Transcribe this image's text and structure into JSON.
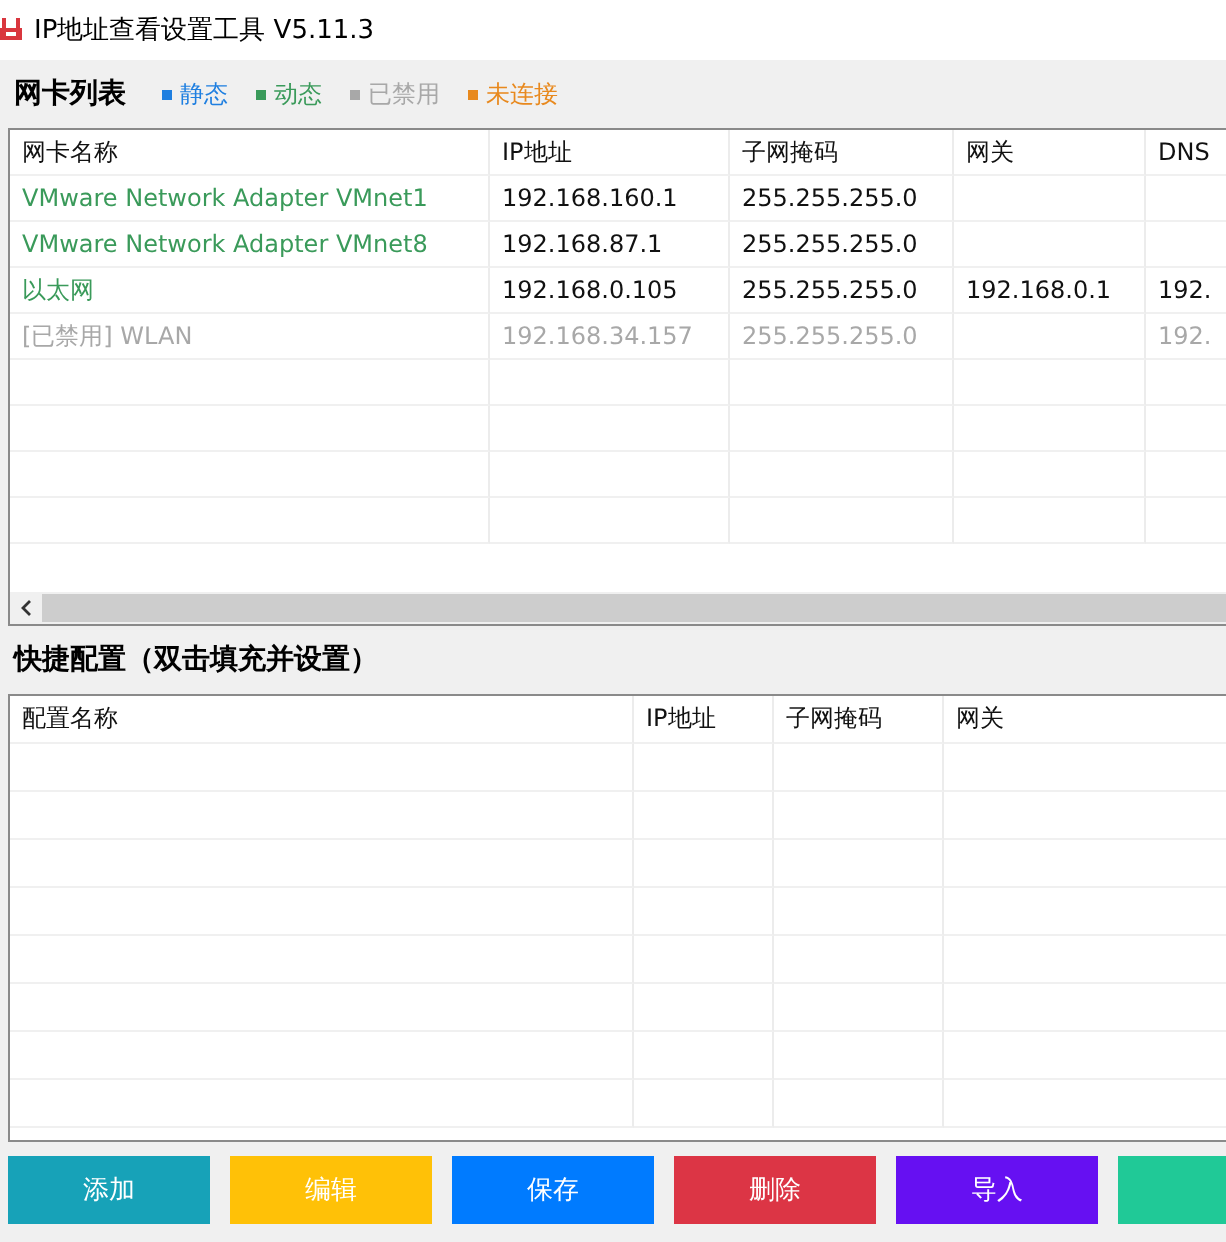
{
  "window": {
    "title": "IP地址查看设置工具 V5.11.3"
  },
  "adapters": {
    "title": "网卡列表",
    "legend": [
      {
        "label": "静态",
        "color": "#1f7fe0"
      },
      {
        "label": "动态",
        "color": "#3a9a5a"
      },
      {
        "label": "已禁用",
        "color": "#a8a8a8"
      },
      {
        "label": "未连接",
        "color": "#e8891e"
      }
    ],
    "columns": [
      "网卡名称",
      "IP地址",
      "子网掩码",
      "网关",
      "DNS"
    ],
    "rows": [
      {
        "color": "#3a9a5a",
        "disabled": false,
        "cells": [
          "VMware Network Adapter VMnet1",
          "192.168.160.1",
          "255.255.255.0",
          "",
          ""
        ]
      },
      {
        "color": "#3a9a5a",
        "disabled": false,
        "cells": [
          "VMware Network Adapter VMnet8",
          "192.168.87.1",
          "255.255.255.0",
          "",
          ""
        ]
      },
      {
        "color": "#3a9a5a",
        "disabled": false,
        "cells": [
          "以太网",
          "192.168.0.105",
          "255.255.255.0",
          "192.168.0.1",
          "192."
        ]
      },
      {
        "color": "#a8a8a8",
        "disabled": true,
        "cells": [
          "[已禁用] WLAN",
          "192.168.34.157",
          "255.255.255.0",
          "",
          "192."
        ]
      }
    ]
  },
  "quick_config": {
    "title": "快捷配置（双击填充并设置）",
    "columns": [
      "配置名称",
      "IP地址",
      "子网掩码",
      "网关"
    ]
  },
  "buttons": [
    {
      "label": "添加",
      "color": "#17a2b8"
    },
    {
      "label": "编辑",
      "color": "#ffc107"
    },
    {
      "label": "保存",
      "color": "#007bff"
    },
    {
      "label": "删除",
      "color": "#dc3545"
    },
    {
      "label": "导入",
      "color": "#6610f2"
    },
    {
      "color": "#20c997"
    }
  ]
}
